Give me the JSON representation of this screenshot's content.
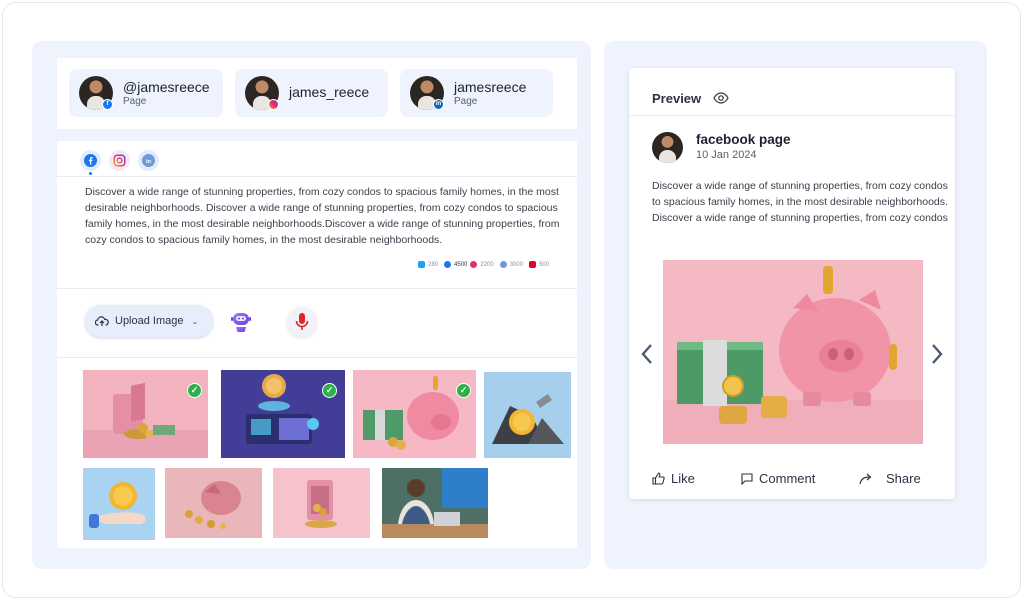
{
  "accounts": [
    {
      "name": "@jamesreece",
      "sub": "Page",
      "network": "facebook-badge-icon"
    },
    {
      "name": "james_reece",
      "sub": "",
      "network": "instagram-badge-icon"
    },
    {
      "name": "jamesreece",
      "sub": "Page",
      "network": "linkedin-badge-icon"
    }
  ],
  "editor": {
    "networks": [
      "facebook-icon",
      "instagram-icon",
      "linkedin-icon"
    ],
    "post_text": "Discover a wide range of stunning properties, from cozy condos to spacious family homes, in the most desirable neighborhoods. Discover a wide range of stunning properties, from cozy condos to spacious family homes, in the most desirable neighborhoods.Discover a wide range of stunning properties, from cozy condos to spacious family homes, in the most desirable neighborhoods.",
    "char_counts": {
      "twitter": "280",
      "facebook": "4500",
      "instagram": "2200",
      "linkedin": "3000",
      "pinterest": "500"
    },
    "upload_label": "Upload Image"
  },
  "gallery": [
    {
      "name": "pink-safe-coins-image",
      "selected": true
    },
    {
      "name": "crypto-machine-image",
      "selected": true
    },
    {
      "name": "piggy-bank-cash-image",
      "selected": true
    },
    {
      "name": "coin-rocks-image",
      "selected": false
    },
    {
      "name": "hand-coin-image",
      "selected": false
    },
    {
      "name": "broken-piggy-image",
      "selected": false
    },
    {
      "name": "open-safe-coins-image",
      "selected": false
    },
    {
      "name": "man-laptop-image",
      "selected": false
    }
  ],
  "preview": {
    "title": "Preview",
    "page_name": "facebook page",
    "date": "10 Jan 2024",
    "text": "Discover a wide range of stunning properties, from cozy condos to spacious family homes, in the most desirable neighborhoods. Discover a wide range of stunning properties, from cozy condos",
    "actions": {
      "like": "Like",
      "comment": "Comment",
      "share": "Share"
    }
  },
  "colors": {
    "accent": "#1877f2",
    "panel_bg": "#eef3fd",
    "check": "#2bb14a",
    "mic": "#e0242c"
  }
}
